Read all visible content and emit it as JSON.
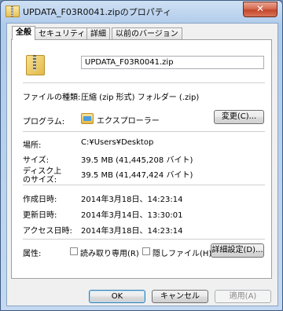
{
  "window": {
    "title": "UPDATA_F03R0041.zipのプロパティ",
    "close_label": "✕"
  },
  "tabs": [
    {
      "label": "全般"
    },
    {
      "label": "セキュリティ"
    },
    {
      "label": "詳細"
    },
    {
      "label": "以前のバージョン"
    }
  ],
  "general": {
    "file_name": "UPDATA_F03R0041.zip",
    "file_type_label": "ファイルの種類:",
    "file_type_value": "圧縮 (zip 形式) フォルダー (.zip)",
    "program_label": "プログラム:",
    "program_value": "エクスプローラー",
    "change_button": "変更(C)...",
    "location_label": "場所:",
    "location_value": "C:¥Users¥Desktop",
    "size_label": "サイズ:",
    "size_value": "39.5 MB (41,445,208 バイト)",
    "disk_size_label_1": "ディスク上",
    "disk_size_label_2": "のサイズ:",
    "disk_size_value": "39.5 MB (41,447,424 バイト)",
    "created_label": "作成日時:",
    "created_value": "2014年3月18日、14:23:14",
    "modified_label": "更新日時:",
    "modified_value": "2014年3月14日、13:30:01",
    "accessed_label": "アクセス日時:",
    "accessed_value": "2014年3月18日、14:23:14",
    "attributes_label": "属性:",
    "readonly_label": "読み取り専用(R)",
    "hidden_label": "隠しファイル(H)",
    "advanced_button": "詳細設定(D)..."
  },
  "footer": {
    "ok": "OK",
    "cancel": "キャンセル",
    "apply": "適用(A)"
  }
}
